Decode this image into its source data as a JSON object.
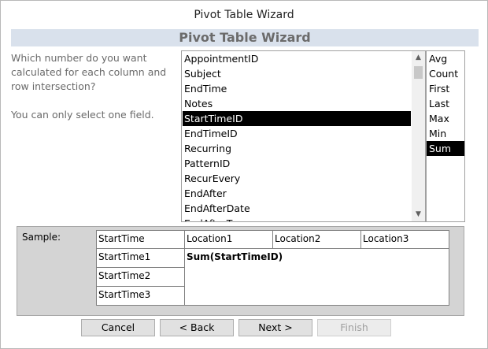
{
  "window": {
    "title": "Pivot Table Wizard"
  },
  "banner": {
    "title": "Pivot Table Wizard"
  },
  "instructions": {
    "question": "Which number do you want calculated for each column and row intersection?",
    "note": "You can only select one field."
  },
  "fields": {
    "items": [
      "AppointmentID",
      "Subject",
      "EndTime",
      "Notes",
      "StartTimeID",
      "EndTimeID",
      "Recurring",
      "PatternID",
      "RecurEvery",
      "EndAfter",
      "EndAfterDate",
      "EndAfterTyp"
    ],
    "selected": "StartTimeID"
  },
  "functions": {
    "items": [
      "Avg",
      "Count",
      "First",
      "Last",
      "Max",
      "Min",
      "Sum"
    ],
    "selected": "Sum"
  },
  "sample": {
    "label": "Sample:",
    "corner": "StartTime",
    "columns": [
      "Location1",
      "Location2",
      "Location3"
    ],
    "rows": [
      "StartTime1",
      "StartTime2",
      "StartTime3"
    ],
    "value": "Sum(StartTimeID)"
  },
  "buttons": {
    "cancel": "Cancel",
    "back": "< Back",
    "next": "Next >",
    "finish": "Finish"
  }
}
